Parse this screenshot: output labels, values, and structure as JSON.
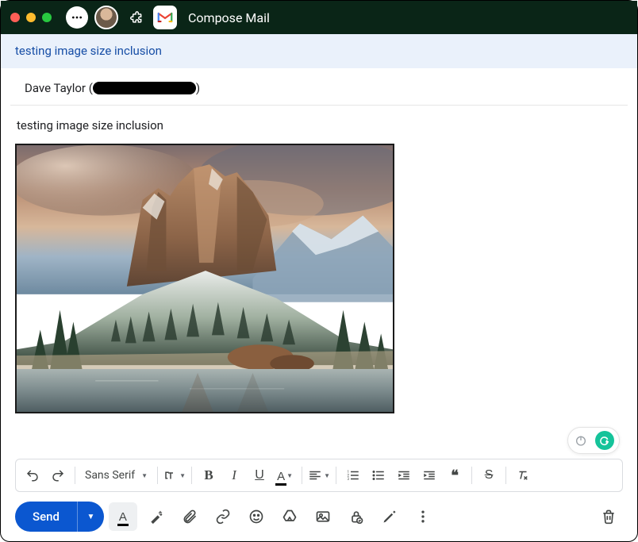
{
  "window": {
    "title": "Compose Mail"
  },
  "subject": "testing image size inclusion",
  "to": {
    "name": "Dave Taylor",
    "open_paren": " (",
    "close_paren": ")"
  },
  "body": {
    "text": "testing image size inclusion"
  },
  "image": {
    "alt": "watercolor-mountain-landscape"
  },
  "formatting": {
    "font": "Sans Serif",
    "undo": "undo",
    "redo": "redo",
    "size": "text-size",
    "bold": "B",
    "italic": "I",
    "underline": "U",
    "color": "A",
    "align": "align-left",
    "list_num": "numbered-list",
    "list_bul": "bulleted-list",
    "indent_less": "indent-decrease",
    "indent_more": "indent-increase",
    "quote": "❝",
    "strike": "S",
    "clear": "clear-formatting"
  },
  "actions": {
    "send": "Send",
    "text_color": "A",
    "magic": "magic-write",
    "attach": "attach",
    "link": "link",
    "emoji": "emoji",
    "drive": "drive",
    "photo": "photo",
    "confidential": "confidential",
    "signature": "signature",
    "more": "more",
    "trash": "delete"
  },
  "grammarly": {
    "power": "power",
    "logo": "G"
  }
}
